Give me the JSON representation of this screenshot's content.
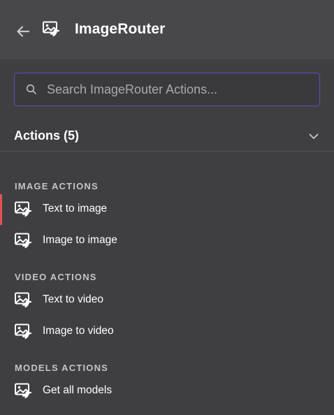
{
  "header": {
    "title": "ImageRouter",
    "back_icon": "arrow-left-icon",
    "app_icon": "image-router-icon"
  },
  "search": {
    "placeholder": "Search ImageRouter Actions...",
    "value": ""
  },
  "actions": {
    "title": "Actions (5)",
    "expanded": true
  },
  "sections": [
    {
      "label": "IMAGE ACTIONS",
      "items": [
        {
          "label": "Text to image",
          "active": true
        },
        {
          "label": "Image to image",
          "active": false
        }
      ]
    },
    {
      "label": "VIDEO ACTIONS",
      "items": [
        {
          "label": "Text to video",
          "active": false
        },
        {
          "label": "Image to video",
          "active": false
        }
      ]
    },
    {
      "label": "MODELS ACTIONS",
      "items": [
        {
          "label": "Get all models",
          "active": false
        }
      ]
    }
  ],
  "colors": {
    "background": "#3f3f42",
    "header_background": "#48484b",
    "search_border": "#5a52b8",
    "active_indicator": "#e05353",
    "section_label": "#c4c4c8"
  }
}
